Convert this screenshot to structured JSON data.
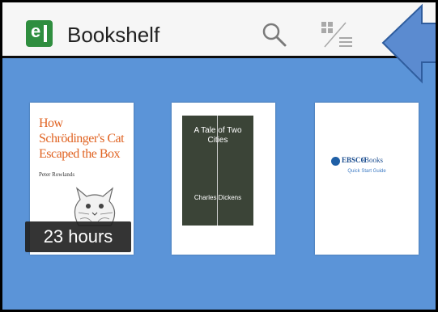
{
  "app": {
    "title": "Bookshelf",
    "logo_letter": "e"
  },
  "toolbar": {
    "search_icon": "search-icon",
    "view_toggle_icon": "grid-list-toggle-icon"
  },
  "annotation": {
    "arrow_icon": "arrow-left-icon",
    "color": "#5b8bd0"
  },
  "books": [
    {
      "title": "How Schrödinger's Cat Escaped the Box",
      "author": "Peter Rowlands",
      "badge": "23 hours"
    },
    {
      "title": "A Tale of Two Cities",
      "author": "Charles Dickens"
    },
    {
      "brand": "EBSCO",
      "brand_suffix": "eBooks",
      "subtitle": "Quick Start Guide"
    }
  ],
  "colors": {
    "shelf_background": "#5b94d8",
    "logo_green": "#2f8e3f",
    "cover_orange": "#e06322"
  }
}
